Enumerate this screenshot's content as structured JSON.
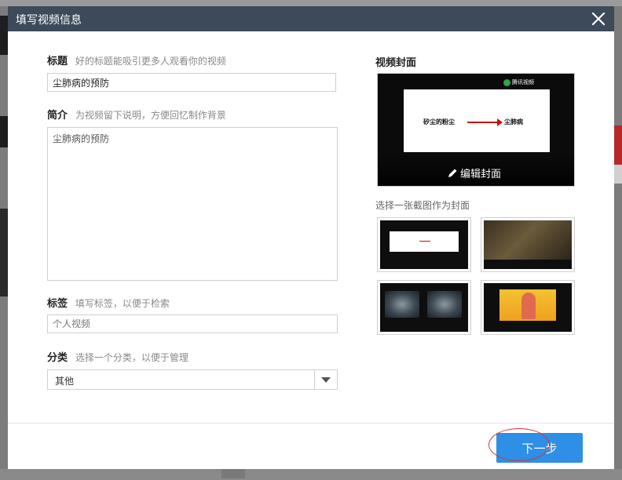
{
  "dialog": {
    "title": "填写视频信息"
  },
  "form": {
    "title_label": "标题",
    "title_hint": "好的标题能吸引更多人观看你的视频",
    "title_value": "尘肺病的预防",
    "intro_label": "简介",
    "intro_hint": "为视频留下说明，方便回忆制作背景",
    "intro_value": "尘肺病的预防",
    "tags_label": "标签",
    "tags_hint": "填写标签，以便于检索",
    "tags_placeholder": "个人视频",
    "category_label": "分类",
    "category_hint": "选择一个分类，以便于管理",
    "category_value": "其他"
  },
  "cover": {
    "heading": "视频封面",
    "edit_label": "编辑封面",
    "choose_label": "选择一张截图作为封面",
    "preview_slide_left": "矽尘的粉尘",
    "preview_slide_right": "尘肺病",
    "watermark": "腾讯视频"
  },
  "footer": {
    "next_label": "下一步"
  },
  "colors": {
    "header": "#3c4a5a",
    "primary_button": "#2d8fe6",
    "annotation_ring": "#d33333"
  },
  "icons": {
    "close": "close-icon",
    "pencil": "pencil-icon",
    "dropdown": "chevron-down-icon"
  }
}
